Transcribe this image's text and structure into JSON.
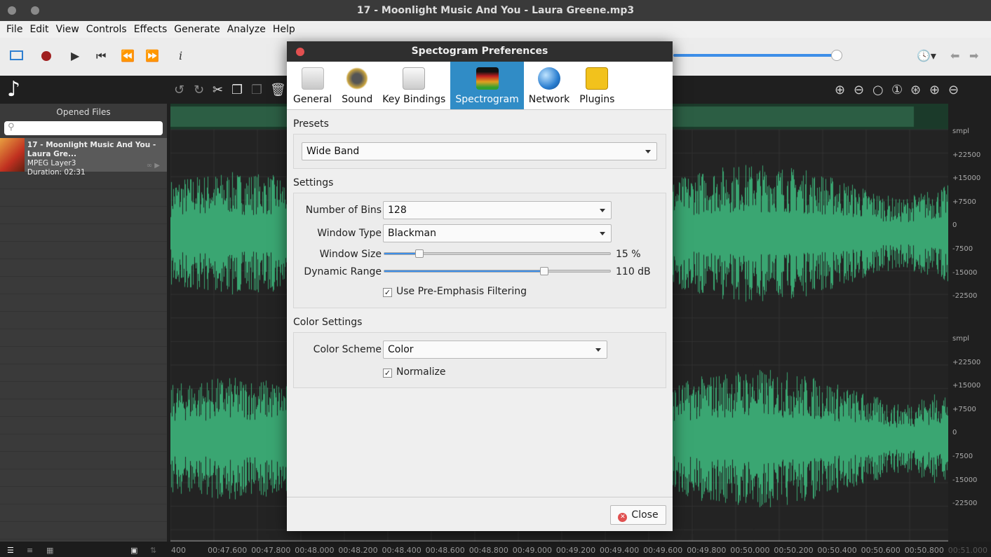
{
  "window": {
    "title": "17 - Moonlight Music And You - Laura Greene.mp3"
  },
  "menu": [
    "File",
    "Edit",
    "View",
    "Controls",
    "Effects",
    "Generate",
    "Analyze",
    "Help"
  ],
  "toolbar": {
    "icons": [
      "view-icon",
      "record-icon",
      "play-icon",
      "skip-back-icon",
      "rewind-icon",
      "fast-forward-icon",
      "info-icon"
    ],
    "seek_percent": 100
  },
  "edit_icons": [
    "undo-icon",
    "redo-icon",
    "cut-icon",
    "copy-icon",
    "paste-icon",
    "delete-icon"
  ],
  "zoom_icons": [
    "zoom-in-icon",
    "zoom-out-icon",
    "zoom-fit-icon",
    "zoom-1-icon",
    "zoom-selection-icon",
    "zoom-in-vertical-icon",
    "zoom-out-vertical-icon"
  ],
  "sidebar": {
    "title": "Opened Files",
    "search_placeholder": "",
    "file": {
      "name": "17 - Moonlight Music And You - Laura Gre...",
      "format": "MPEG Layer3",
      "duration": "Duration: 02:31"
    }
  },
  "amp_axis": [
    "smpl",
    "+22500",
    "+15000",
    "+7500",
    "0",
    "-7500",
    "-15000",
    "-22500"
  ],
  "time_axis": [
    "400",
    "00:47.600",
    "00:47.800",
    "00:48.000",
    "00:48.200",
    "00:48.400",
    "00:48.600",
    "00:48.800",
    "00:49.000",
    "00:49.200",
    "00:49.400",
    "00:49.600",
    "00:49.800",
    "00:50.000",
    "00:50.200",
    "00:50.400",
    "00:50.600",
    "00:50.800",
    "00:51.000"
  ],
  "colors": {
    "waveform": "#3aa672",
    "accent": "#308cc6"
  },
  "dialog": {
    "title": "Spectogram Preferences",
    "tabs": [
      {
        "label": "General"
      },
      {
        "label": "Sound"
      },
      {
        "label": "Key Bindings"
      },
      {
        "label": "Spectrogram",
        "selected": true
      },
      {
        "label": "Network"
      },
      {
        "label": "Plugins"
      }
    ],
    "presets_label": "Presets",
    "preset": "Wide Band",
    "settings_label": "Settings",
    "bins_label": "Number of Bins",
    "bins": "128",
    "window_type_label": "Window Type",
    "window_type": "Blackman",
    "window_size_label": "Window Size",
    "window_size": "15 %",
    "window_size_value": 15,
    "dynamic_range_label": "Dynamic Range",
    "dynamic_range": "110 dB",
    "dynamic_range_percent": 70,
    "pre_emphasis_label": "Use Pre-Emphasis Filtering",
    "pre_emphasis": true,
    "color_settings_label": "Color Settings",
    "color_scheme_label": "Color Scheme",
    "color_scheme": "Color",
    "normalize_label": "Normalize",
    "normalize": true,
    "close_label": "Close"
  }
}
